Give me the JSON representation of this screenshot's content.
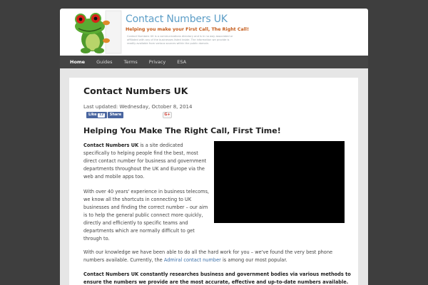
{
  "header": {
    "logo_title": "Contact Numbers UK",
    "logo_tagline": "Helping you make your First Call, The Right Call!",
    "logo_blurb": "Contact Numbers UK is a communications directory and is in no way associated or affiliated with any of the businesses listed inside. The information we provide is readily available from various sources within the public domain."
  },
  "nav": {
    "items": [
      {
        "label": "Home"
      },
      {
        "label": "Guides"
      },
      {
        "label": "Terms"
      },
      {
        "label": "Privacy"
      },
      {
        "label": "ESA"
      }
    ],
    "active": "Home"
  },
  "article": {
    "title": "Contact Numbers UK",
    "updated": "Last updated: Wednesday, October 8, 2014",
    "share": {
      "fb_like_label": "Like",
      "fb_like_count": "12",
      "fb_share_label": "Share",
      "gplus_label": "G+"
    },
    "heading": "Helping You Make The Right Call, First Time!",
    "p1_bold": "Contact Numbers UK",
    "p1_rest": " is a site dedicated specifically to helping people find the best, most direct contact number for business and government departments throughout the UK and Europe via the web and mobile apps too.",
    "p2": "With over 40 years' experience in business telecoms, we know all the shortcuts in connecting to UK businesses and finding the correct number – our aim is to help the general public connect more quickly, directly and efficiently to specific teams and departments which are normally difficult to get through to.",
    "p3_a": "With our knowledge we have been able to do all the hard work for you – we've found the very best phone numbers available. Currently, the ",
    "p3_link": "Admiral contact number",
    "p3_b": " is among our most popular.",
    "p4": "Contact Numbers UK constantly researches business and government bodies via various methods to ensure the numbers we provide are the most accurate, effective and up-to-date numbers available."
  },
  "colors": {
    "page_bg": "#3e3e3e",
    "nav_bg": "#454545",
    "logo_blue": "#5d9ec7",
    "tagline_orange": "#c45b1a",
    "facebook_blue": "#4a66a0",
    "link_blue": "#3b6fa8"
  }
}
